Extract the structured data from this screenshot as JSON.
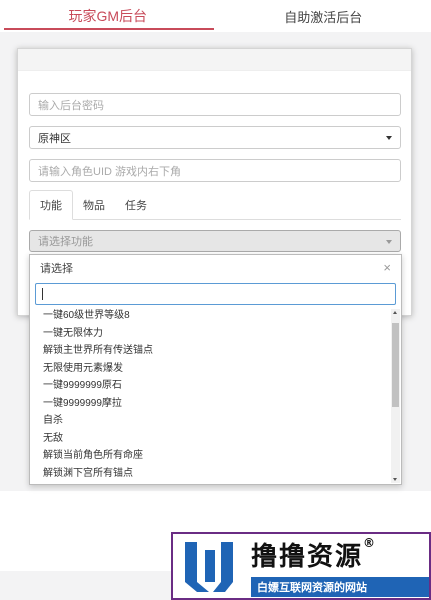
{
  "top_tabs": [
    {
      "label": "玩家GM后台",
      "active": true
    },
    {
      "label": "自助激活后台",
      "active": false
    }
  ],
  "form": {
    "password_placeholder": "输入后台密码",
    "server_value": "原神区",
    "uid_placeholder": "请输入角色UID 游戏内右下角",
    "subtabs": [
      {
        "label": "功能",
        "active": true
      },
      {
        "label": "物品",
        "active": false
      },
      {
        "label": "任务",
        "active": false
      }
    ],
    "function_placeholder": "请选择功能"
  },
  "dropdown": {
    "header": "请选择",
    "close_glyph": "×",
    "search_value": "",
    "items": [
      "一键60级世界等级8",
      "一键无限体力",
      "解锁主世界所有传送锚点",
      "无限使用元素爆发",
      "一键9999999原石",
      "一键9999999摩拉",
      "自杀",
      "无敌",
      "解锁当前角色所有命座",
      "解锁渊下宫所有锚点"
    ]
  },
  "watermark": {
    "title": "撸撸资源",
    "registered": "®",
    "subtitle": "白嫖互联网资源的网站"
  },
  "colors": {
    "accent": "#c84b5a",
    "focus": "#5b9bd5",
    "watermark_border": "#6a2c84",
    "watermark_blue": "#1f64b5"
  }
}
